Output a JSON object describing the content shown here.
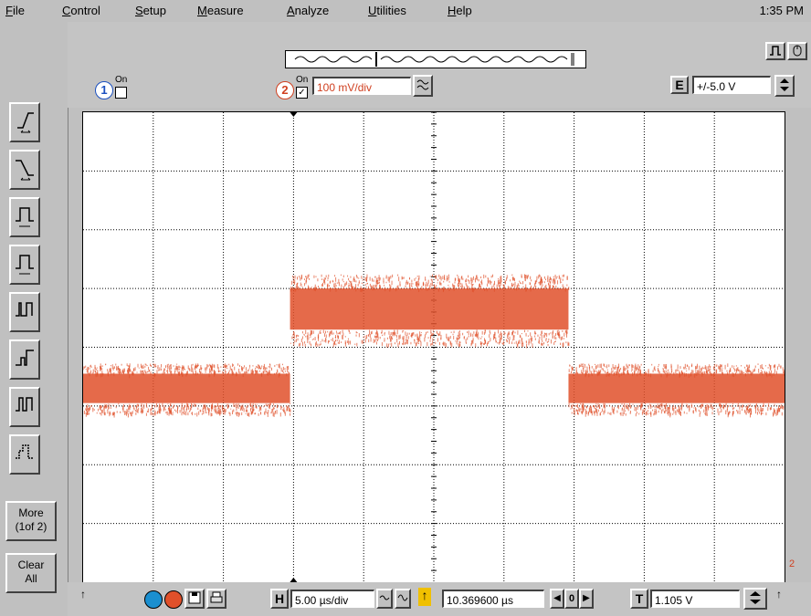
{
  "menu": {
    "items": [
      {
        "label": "File",
        "underline": "F",
        "rest": "ile"
      },
      {
        "label": "Control",
        "underline": "C",
        "rest": "ontrol"
      },
      {
        "label": "Setup",
        "underline": "S",
        "rest": "etup"
      },
      {
        "label": "Measure",
        "underline": "M",
        "rest": "easure"
      },
      {
        "label": "Analyze",
        "underline": "A",
        "rest": "nalyze"
      },
      {
        "label": "Utilities",
        "underline": "U",
        "rest": "tilities"
      },
      {
        "label": "Help",
        "underline": "H",
        "rest": "elp"
      }
    ],
    "clock": "1:35 PM"
  },
  "channels": {
    "ch1": {
      "number": "1",
      "on_label": "On",
      "checked": false
    },
    "ch2": {
      "number": "2",
      "on_label": "On",
      "checked": true,
      "scale": "100 mV/div"
    }
  },
  "external": {
    "badge": "E",
    "range": "+/-5.0 V"
  },
  "sidebar": {
    "more_label_1": "More",
    "more_label_2": "(1of 2)",
    "clear_label_1": "Clear",
    "clear_label_2": "All",
    "tools": [
      "rising-edge-trigger-icon",
      "falling-edge-trigger-icon",
      "pulse-width-trigger-icon",
      "pulse-width-ratio-trigger-icon",
      "glitch-trigger-icon",
      "runt-trigger-icon",
      "pulse-pair-trigger-icon",
      "pattern-trigger-icon"
    ]
  },
  "bottom": {
    "h_badge": "H",
    "timebase": "5.00 µs/div",
    "delay": "10.369600 µs",
    "delay_zero": "0",
    "t_badge": "T",
    "trigger_level": "1.105 V"
  },
  "colors": {
    "trace": "#e0502a",
    "ch1": "#1a4fbf",
    "ch2": "#d04020"
  },
  "marker_label": "2"
}
